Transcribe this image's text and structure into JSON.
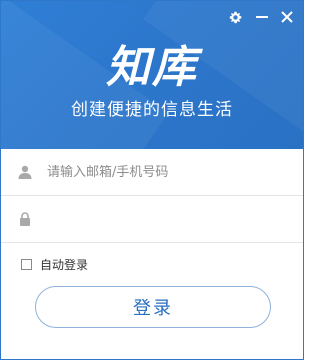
{
  "header": {
    "logo_text": "知库",
    "slogan": "创建便捷的信息生活"
  },
  "window_controls": {
    "settings_icon": "gear-icon",
    "minimize_icon": "minimize-icon",
    "close_icon": "close-icon"
  },
  "form": {
    "username": {
      "icon": "user-icon",
      "value": "",
      "placeholder": "请输入邮箱/手机号码"
    },
    "password": {
      "icon": "lock-icon",
      "value": "",
      "placeholder": ""
    },
    "auto_login": {
      "label": "自动登录",
      "checked": false
    },
    "login_button_label": "登录"
  },
  "colors": {
    "brand_blue": "#2c76cb",
    "button_text": "#2a6fc0",
    "button_border": "#8fb3dc"
  }
}
